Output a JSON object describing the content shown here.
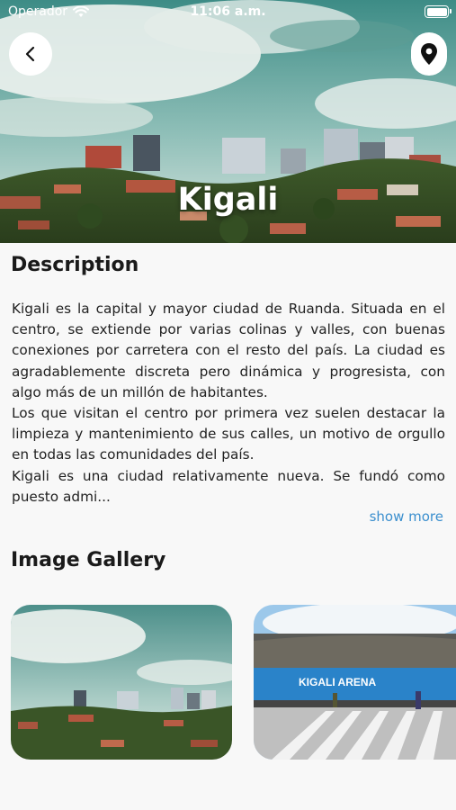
{
  "status_bar": {
    "carrier": "Operador",
    "time": "11:06 a.m.",
    "battery_level": 1.0
  },
  "header": {
    "title": "Kigali",
    "back_icon": "chevron-left-icon",
    "location_icon": "map-pin-icon"
  },
  "description": {
    "title": "Description",
    "paragraphs": [
      "Kigali es la capital y mayor ciudad de Ruanda. Situada en el centro, se extiende por varias colinas y valles, con buenas conexiones por carretera con el resto del país. La ciudad es agradablemente discreta pero dinámica y progresista, con algo más de un millón de habitantes.",
      "Los que visitan el centro por primera vez suelen destacar la limpieza y mantenimiento de sus calles, un motivo de orgullo en todas las comunidades del país.",
      "Kigali es una ciudad relativamente nueva. Se fundó como puesto admi..."
    ],
    "show_more": "show more"
  },
  "gallery": {
    "title": "Image Gallery",
    "arena_sign": "KIGALI ARENA"
  },
  "colors": {
    "accent": "#3b8fce",
    "background": "#f8f8f8",
    "title_text": "#1a1a1a"
  }
}
